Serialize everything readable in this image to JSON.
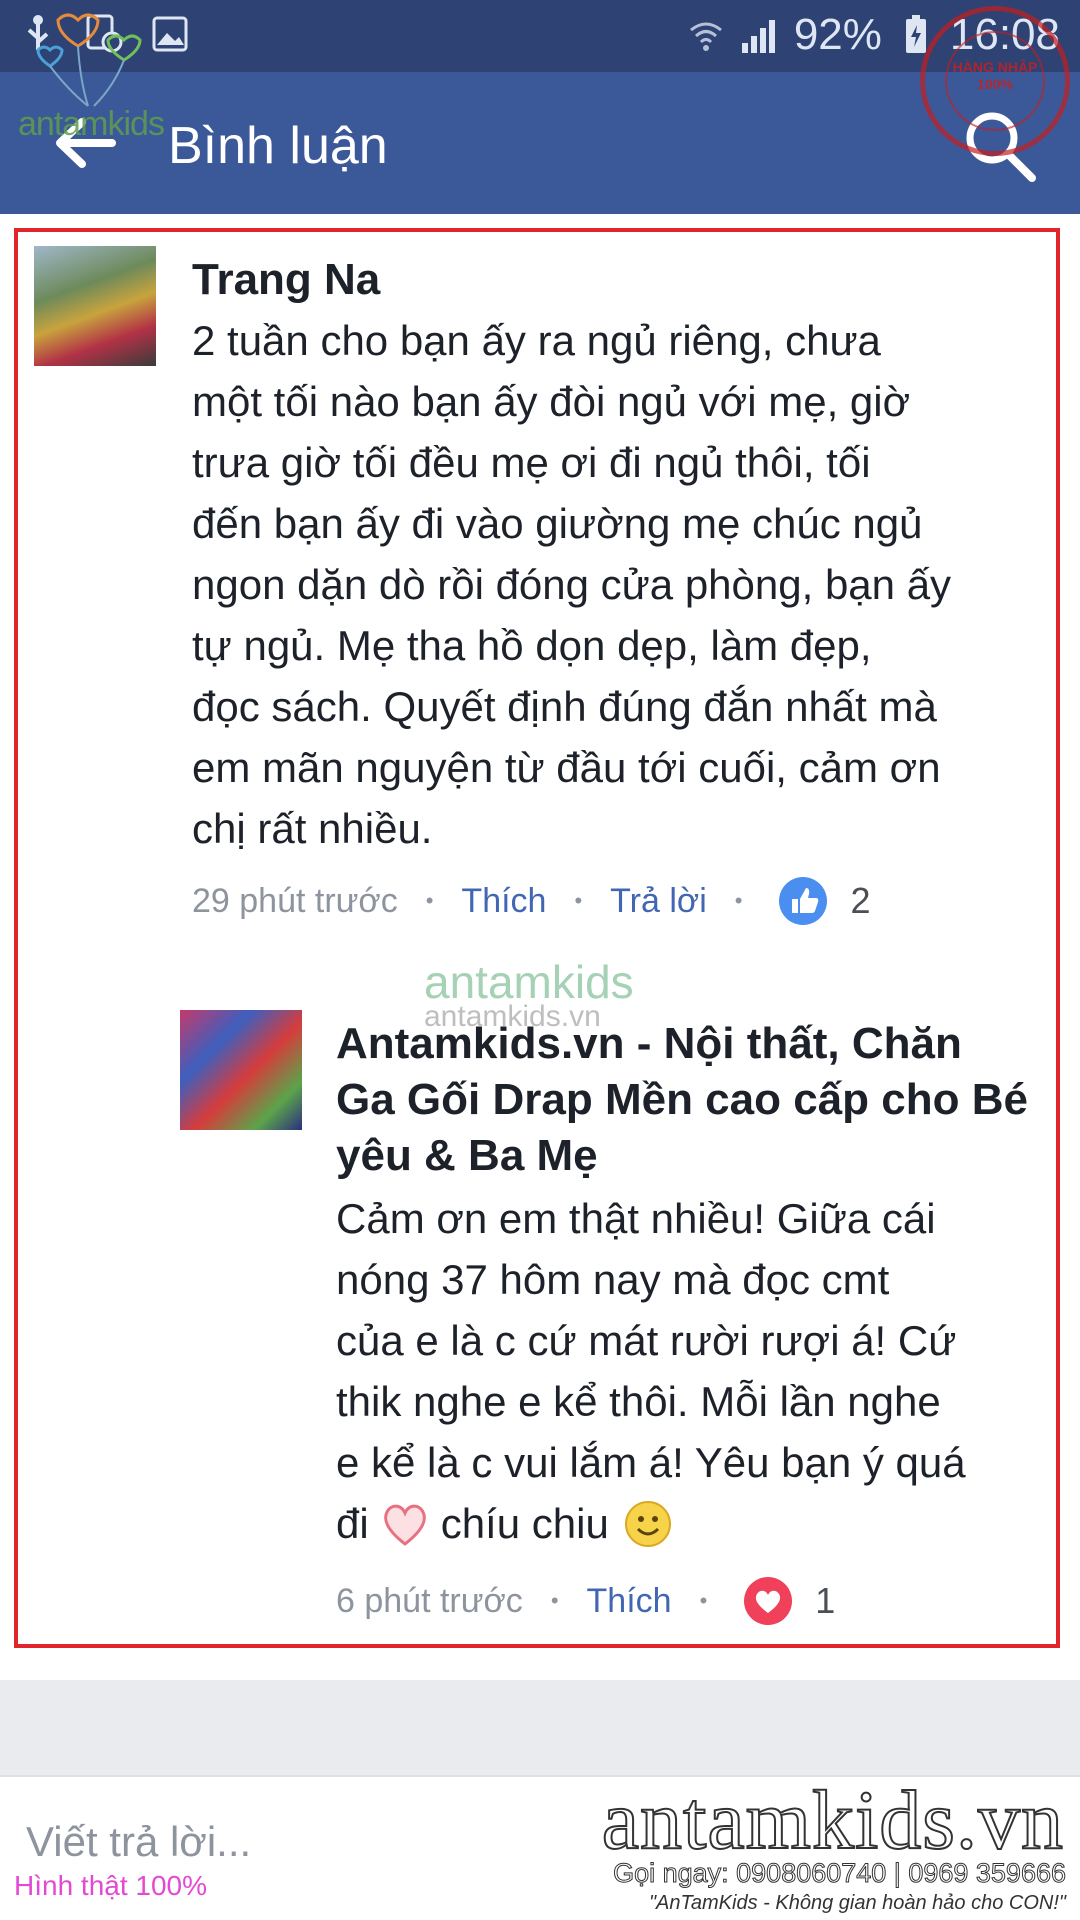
{
  "status_bar": {
    "battery_percent": "92%",
    "clock": "16:08"
  },
  "app_bar": {
    "title": "Bình luận"
  },
  "watermark": {
    "logo": "antamkids",
    "center_logo": "antamkids",
    "center_url": "antamkids.vn",
    "big_site": "antamkids.vn",
    "phone": "Gọi ngay: 0908060740 | 0969 359666",
    "slogan": "\"AnTamKids - Không gian hoàn hảo cho CON!\"",
    "stamp_text": "HÀNG NHẬP 100%",
    "hinh_that": "Hình thật 100%"
  },
  "comments": [
    {
      "author": "Trang Na",
      "lines": [
        "2 tuần cho bạn ấy ra ngủ riêng, chưa",
        "một tối nào bạn ấy đòi ngủ với mẹ, giờ",
        "trưa giờ tối đều mẹ ơi đi ngủ thôi, tối",
        "đến bạn ấy đi vào giường mẹ chúc ngủ",
        "ngon dặn dò rồi đóng cửa phòng, bạn ấy",
        "tự ngủ. Mẹ tha hồ dọn dẹp, làm đẹp,",
        "đọc sách. Quyết định đúng đắn nhất mà",
        "em mãn nguyện từ đầu tới cuối, cảm ơn",
        "chị rất nhiều."
      ],
      "time": "29 phút trước",
      "like_label": "Thích",
      "reply_label": "Trả lời",
      "reaction": "like",
      "reaction_count": "2"
    },
    {
      "author_lines": [
        "Antamkids.vn - Nội thất, Chăn",
        "Ga Gối Drap Mền cao cấp cho Bé",
        "yêu & Ba Mẹ"
      ],
      "lines": [
        "Cảm ơn em thật nhiều! Giữa cái",
        "nóng 37 hôm nay mà đọc cmt",
        "của e là c cứ mát rười rượi á! Cứ",
        "thik nghe e kể thôi. Mỗi lần nghe",
        "e kể là c vui lắm á! Yêu bạn ý quá",
        "đi",
        "chíu chiu"
      ],
      "time": "6 phút trước",
      "like_label": "Thích",
      "reaction": "love",
      "reaction_count": "1"
    }
  ],
  "reply_bar": {
    "placeholder": "Viết trả lời..."
  },
  "colors": {
    "status_bar": "#2e4274",
    "app_bar": "#3b5998",
    "frame": "#e0262a",
    "link": "#4267b2",
    "like_blue": "#4a8ef0",
    "love_red": "#f0405a"
  }
}
